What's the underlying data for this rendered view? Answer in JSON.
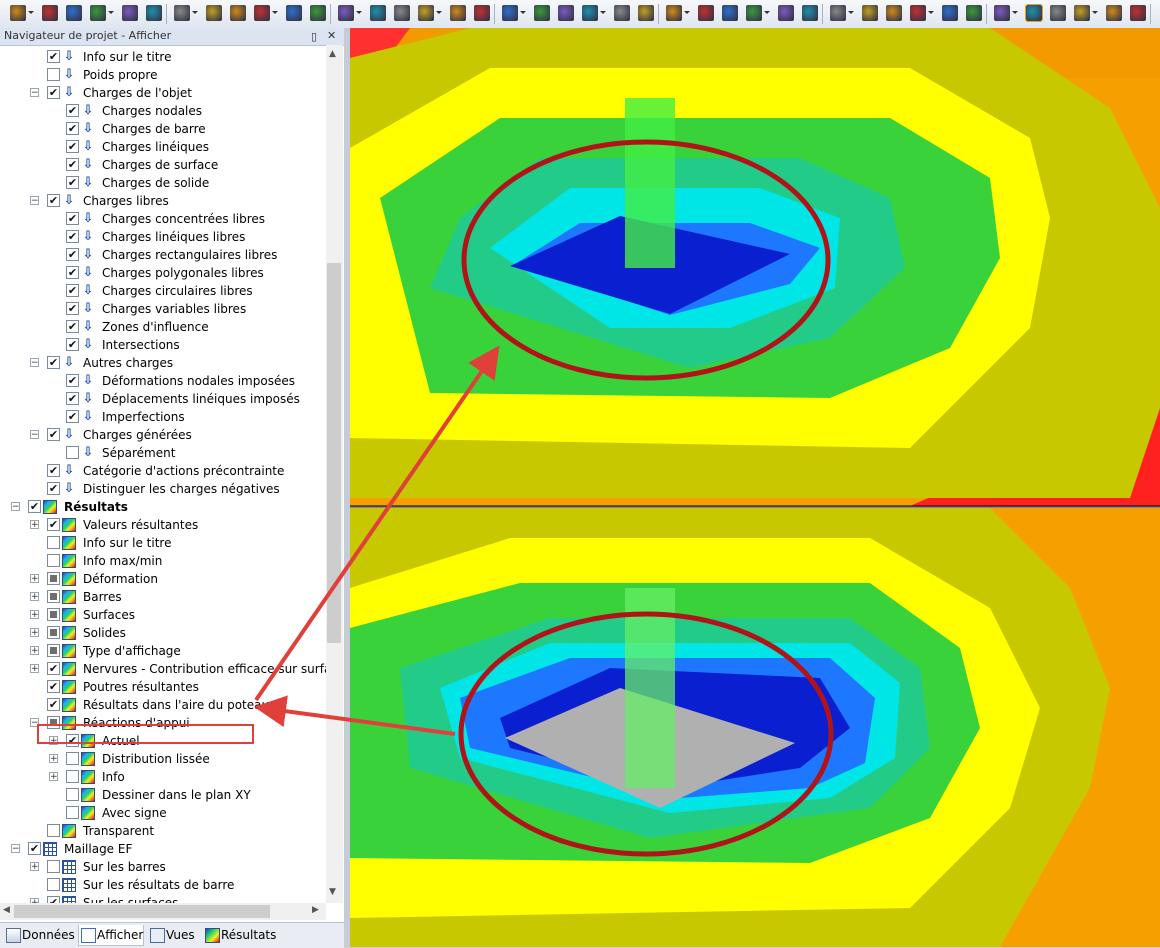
{
  "colors": {
    "accent_red": "#e0403a",
    "ellipse_red": "#b01418",
    "header_bg": "#dbe4f0"
  },
  "navigator": {
    "title": "Navigateur de projet - Afficher",
    "pin_icon": "pin-icon",
    "close_icon": "close-icon",
    "items": [
      {
        "label": "Info sur le titre",
        "level": 2,
        "checked": "on",
        "icon": "load",
        "expander": ""
      },
      {
        "label": "Poids propre",
        "level": 2,
        "checked": "off",
        "icon": "load",
        "expander": ""
      },
      {
        "label": "Charges de l'objet",
        "level": 2,
        "checked": "on",
        "icon": "load",
        "expander": "−"
      },
      {
        "label": "Charges nodales",
        "level": 3,
        "checked": "on",
        "icon": "load",
        "expander": ""
      },
      {
        "label": "Charges de barre",
        "level": 3,
        "checked": "on",
        "icon": "load",
        "expander": ""
      },
      {
        "label": "Charges linéiques",
        "level": 3,
        "checked": "on",
        "icon": "load",
        "expander": ""
      },
      {
        "label": "Charges de surface",
        "level": 3,
        "checked": "on",
        "icon": "load",
        "expander": ""
      },
      {
        "label": "Charges de solide",
        "level": 3,
        "checked": "on",
        "icon": "load",
        "expander": ""
      },
      {
        "label": "Charges libres",
        "level": 2,
        "checked": "on",
        "icon": "load",
        "expander": "−"
      },
      {
        "label": "Charges concentrées libres",
        "level": 3,
        "checked": "on",
        "icon": "load",
        "expander": ""
      },
      {
        "label": "Charges linéiques libres",
        "level": 3,
        "checked": "on",
        "icon": "load",
        "expander": ""
      },
      {
        "label": "Charges rectangulaires libres",
        "level": 3,
        "checked": "on",
        "icon": "load",
        "expander": ""
      },
      {
        "label": "Charges polygonales libres",
        "level": 3,
        "checked": "on",
        "icon": "load",
        "expander": ""
      },
      {
        "label": "Charges circulaires libres",
        "level": 3,
        "checked": "on",
        "icon": "load",
        "expander": ""
      },
      {
        "label": "Charges variables libres",
        "level": 3,
        "checked": "on",
        "icon": "load",
        "expander": ""
      },
      {
        "label": "Zones d'influence",
        "level": 3,
        "checked": "on",
        "icon": "load",
        "expander": ""
      },
      {
        "label": "Intersections",
        "level": 3,
        "checked": "on",
        "icon": "load",
        "expander": ""
      },
      {
        "label": "Autres charges",
        "level": 2,
        "checked": "on",
        "icon": "load",
        "expander": "−"
      },
      {
        "label": "Déformations nodales imposées",
        "level": 3,
        "checked": "on",
        "icon": "load",
        "expander": ""
      },
      {
        "label": "Déplacements linéiques imposés",
        "level": 3,
        "checked": "on",
        "icon": "load",
        "expander": ""
      },
      {
        "label": "Imperfections",
        "level": 3,
        "checked": "on",
        "icon": "load",
        "expander": ""
      },
      {
        "label": "Charges générées",
        "level": 2,
        "checked": "on",
        "icon": "load",
        "expander": "−"
      },
      {
        "label": "Séparément",
        "level": 3,
        "checked": "off",
        "icon": "load",
        "expander": ""
      },
      {
        "label": "Catégorie d'actions précontrainte",
        "level": 2,
        "checked": "on",
        "icon": "load",
        "expander": ""
      },
      {
        "label": "Distinguer les charges négatives",
        "level": 2,
        "checked": "on",
        "icon": "load",
        "expander": ""
      },
      {
        "label": "Résultats",
        "level": 1,
        "checked": "on",
        "icon": "res",
        "expander": "−",
        "bold": true
      },
      {
        "label": "Valeurs résultantes",
        "level": 2,
        "checked": "on",
        "icon": "res",
        "expander": "+"
      },
      {
        "label": "Info sur le titre",
        "level": 2,
        "checked": "off",
        "icon": "res",
        "expander": ""
      },
      {
        "label": "Info max/min",
        "level": 2,
        "checked": "off",
        "icon": "res",
        "expander": ""
      },
      {
        "label": "Déformation",
        "level": 2,
        "checked": "part",
        "icon": "res",
        "expander": "+"
      },
      {
        "label": "Barres",
        "level": 2,
        "checked": "part",
        "icon": "res",
        "expander": "+"
      },
      {
        "label": "Surfaces",
        "level": 2,
        "checked": "part",
        "icon": "res",
        "expander": "+"
      },
      {
        "label": "Solides",
        "level": 2,
        "checked": "part",
        "icon": "res",
        "expander": "+"
      },
      {
        "label": "Type d'affichage",
        "level": 2,
        "checked": "part",
        "icon": "res",
        "expander": "+"
      },
      {
        "label": "Nervures - Contribution efficace sur surface/b",
        "level": 2,
        "checked": "on",
        "icon": "res",
        "expander": "+"
      },
      {
        "label": "Poutres résultantes",
        "level": 2,
        "checked": "on",
        "icon": "res",
        "expander": ""
      },
      {
        "label": "Résultats dans l'aire du poteau",
        "level": 2,
        "checked": "on",
        "icon": "res",
        "expander": ""
      },
      {
        "label": "Réactions d'appui",
        "level": 2,
        "checked": "part",
        "icon": "res",
        "expander": "−"
      },
      {
        "label": "Actuel",
        "level": 3,
        "checked": "on",
        "icon": "res",
        "expander": "+"
      },
      {
        "label": "Distribution lissée",
        "level": 3,
        "checked": "off",
        "icon": "res",
        "expander": "+"
      },
      {
        "label": "Info",
        "level": 3,
        "checked": "off",
        "icon": "res",
        "expander": "+"
      },
      {
        "label": "Dessiner dans le plan XY",
        "level": 3,
        "checked": "off",
        "icon": "res",
        "expander": ""
      },
      {
        "label": "Avec signe",
        "level": 3,
        "checked": "off",
        "icon": "res",
        "expander": ""
      },
      {
        "label": "Transparent",
        "level": 2,
        "checked": "off",
        "icon": "res",
        "expander": ""
      },
      {
        "label": "Maillage EF",
        "level": 1,
        "checked": "on",
        "icon": "mesh",
        "expander": "−"
      },
      {
        "label": "Sur les barres",
        "level": 2,
        "checked": "off",
        "icon": "mesh",
        "expander": "+"
      },
      {
        "label": "Sur les résultats de barre",
        "level": 2,
        "checked": "off",
        "icon": "mesh",
        "expander": ""
      },
      {
        "label": "Sur les surfaces",
        "level": 2,
        "checked": "on",
        "icon": "mesh",
        "expander": "+"
      }
    ],
    "tabs": [
      {
        "label": "Données",
        "icon": "data-icon"
      },
      {
        "label": "Afficher",
        "icon": "display-icon"
      },
      {
        "label": "Vues",
        "icon": "views-icon"
      },
      {
        "label": "Résultats",
        "icon": "results-icon"
      }
    ]
  }
}
